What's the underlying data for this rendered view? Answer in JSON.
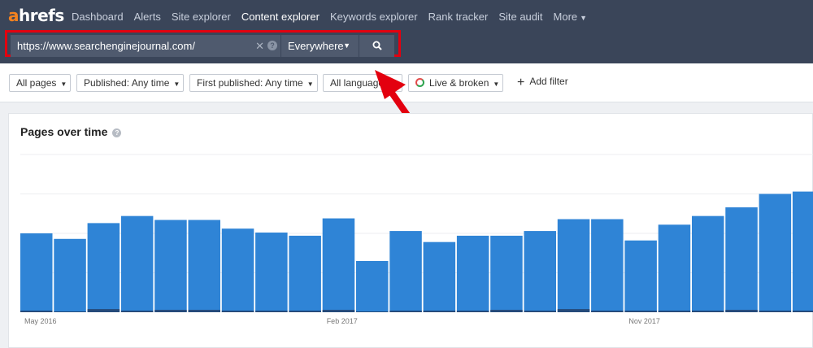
{
  "app": {
    "logo_a": "a",
    "logo_rest": "hrefs"
  },
  "nav": {
    "items": [
      {
        "label": "Dashboard",
        "name": "nav-dashboard"
      },
      {
        "label": "Alerts",
        "name": "nav-alerts"
      },
      {
        "label": "Site explorer",
        "name": "nav-site-explorer"
      },
      {
        "label": "Content explorer",
        "name": "nav-content-explorer",
        "active": true
      },
      {
        "label": "Keywords explorer",
        "name": "nav-keywords-explorer"
      },
      {
        "label": "Rank tracker",
        "name": "nav-rank-tracker"
      },
      {
        "label": "Site audit",
        "name": "nav-site-audit"
      }
    ],
    "more_label": "More"
  },
  "search": {
    "value": "https://www.searchenginejournal.com/",
    "mode": "Everywhere",
    "search_icon": "search-icon"
  },
  "filters": {
    "all_pages": "All pages",
    "published": "Published: Any time",
    "first_published": "First published: Any time",
    "all_languages": "All languages",
    "live_broken": "Live & broken",
    "add_filter": "Add filter"
  },
  "colors": {
    "nav_bg": "#3a4559",
    "accent": "#f4821f",
    "bar": "#2f84d6",
    "bar_dark": "#254a7a",
    "highlight_border": "#e3000f"
  },
  "chart": {
    "title": "Pages over time",
    "help": "?"
  },
  "chart_data": {
    "type": "bar",
    "title": "Pages over time",
    "x_tick_labels": [
      "May 2016",
      "Feb 2017",
      "Nov 2017"
    ],
    "values": [
      100,
      93,
      113,
      122,
      117,
      117,
      106,
      101,
      97,
      119,
      65,
      103,
      89,
      97,
      97,
      103,
      118,
      118,
      91,
      111,
      122,
      133,
      150,
      153
    ],
    "secondary_values": [
      2,
      1,
      4,
      2,
      3,
      3,
      2,
      2,
      2,
      3,
      1,
      2,
      2,
      2,
      3,
      2,
      4,
      2,
      2,
      2,
      2,
      3,
      2,
      2
    ],
    "ylim": [
      0,
      200
    ],
    "grid": true
  }
}
